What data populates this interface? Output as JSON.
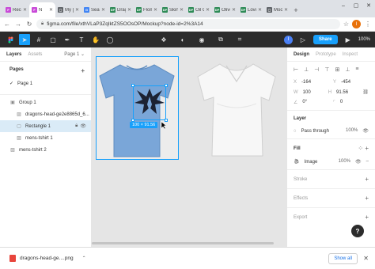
{
  "browser": {
    "tabs": [
      {
        "title": "Rece",
        "favicon_color": "#c94ad8",
        "favicon_glyph": "F",
        "active": false
      },
      {
        "title": "N",
        "favicon_color": "#c94ad8",
        "favicon_glyph": "F",
        "active": true
      },
      {
        "title": "My [",
        "favicon_color": "#5f6368",
        "favicon_glyph": "▢",
        "active": false
      },
      {
        "title": "Sear",
        "favicon_color": "#4285f4",
        "favicon_glyph": "G",
        "active": false
      },
      {
        "title": "Drag",
        "favicon_color": "#2e8b57",
        "favicon_glyph": "DP",
        "active": false
      },
      {
        "title": "Flom",
        "favicon_color": "#2e8b57",
        "favicon_glyph": "DP",
        "active": false
      },
      {
        "title": "Skirt",
        "favicon_color": "#2e8b57",
        "favicon_glyph": "DP",
        "active": false
      },
      {
        "title": "Oil C",
        "favicon_color": "#2e8b57",
        "favicon_glyph": "DP",
        "active": false
      },
      {
        "title": "Olive",
        "favicon_color": "#2e8b57",
        "favicon_glyph": "DP",
        "active": false
      },
      {
        "title": "Lovc",
        "favicon_color": "#2e8b57",
        "favicon_glyph": "DP",
        "active": false
      },
      {
        "title": "Moc",
        "favicon_color": "#5f6368",
        "favicon_glyph": "▢",
        "active": false
      }
    ],
    "new_tab": "+",
    "url": "figma.com/file/xthVLaP3ZqIktZS5OOsOP/Mockup?node-id=2%3A14",
    "profile_initial": "I"
  },
  "figma": {
    "toolbar": {
      "avatar_initial": "I",
      "share_label": "Share",
      "zoom_label": "100%"
    },
    "left": {
      "tab_layers": "Layers",
      "tab_assets": "Assets",
      "page_selector": "Page 1",
      "pages_header": "Pages",
      "current_page": "Page 1",
      "layers": [
        {
          "name": "Group 1",
          "icon": "▣",
          "indent": 12,
          "state": "normal"
        },
        {
          "name": "dragons-head-ge2e8865d_6...",
          "icon": "▨",
          "indent": 20,
          "state": "normal"
        },
        {
          "name": "Rectangle 1",
          "icon": "▢",
          "indent": 20,
          "state": "selected"
        },
        {
          "name": "mens-tshirt 1",
          "icon": "▨",
          "indent": 20,
          "state": "normal"
        },
        {
          "name": "mens-tshirt 2",
          "icon": "▨",
          "indent": 12,
          "state": "normal"
        }
      ]
    },
    "canvas": {
      "dimension_label": "100 × 91.56"
    },
    "right": {
      "tab_design": "Design",
      "tab_prototype": "Prototype",
      "tab_inspect": "Inspect",
      "x_label": "X",
      "x_value": "-164",
      "y_label": "Y",
      "y_value": "-454",
      "w_label": "W",
      "w_value": "100",
      "h_label": "H",
      "h_value": "91.56",
      "rotation_value": "0°",
      "radius_value": "0",
      "layer_header": "Layer",
      "blend_mode": "Pass through",
      "layer_opacity": "100%",
      "fill_header": "Fill",
      "fill_type": "Image",
      "fill_opacity": "100%",
      "stroke_header": "Stroke",
      "effects_header": "Effects",
      "export_header": "Export",
      "help_label": "?"
    }
  },
  "downloads": {
    "file_name": "dragons-head-ge....png",
    "show_all_label": "Show all"
  },
  "colors": {
    "accent": "#18a0fb",
    "tshirt_blue": "#7aa6d8",
    "toolbar_bg": "#2c2c2c"
  }
}
